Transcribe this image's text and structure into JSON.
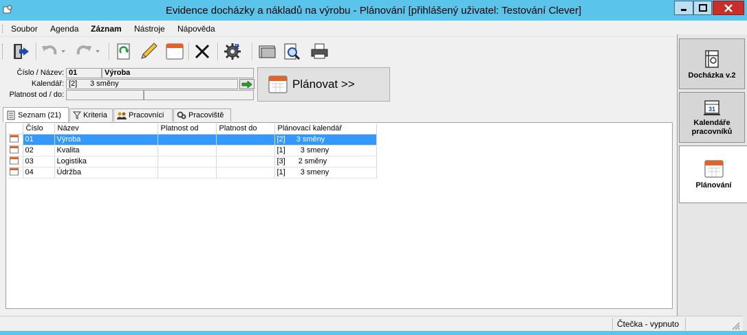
{
  "window": {
    "title": "Evidence docházky a nákladů na výrobu - Plánování [přihlášený uživatel: Testování Clever]"
  },
  "menu": [
    "Soubor",
    "Agenda",
    "Záznam",
    "Nástroje",
    "Nápověda"
  ],
  "toolbar": [
    "exit-icon",
    "undo-icon",
    "redo-icon",
    "refresh-icon",
    "edit-pencil-icon",
    "calendar-icon",
    "delete-icon",
    "settings-gear-icon",
    "folder-icon",
    "print-preview-icon",
    "print-icon"
  ],
  "form": {
    "cislo_label": "Číslo / Název:",
    "cislo": "01",
    "nazev": "Výroba",
    "kalendar_label": "Kalendář:",
    "kalendar_code": "[2]",
    "kalendar_name": "3 směny",
    "platnost_label": "Platnost od / do:",
    "platnost_od": "",
    "platnost_do": ""
  },
  "plan_button": {
    "label": "Plánovat >>"
  },
  "tabs": [
    "Seznam (21)",
    "Kriteria",
    "Pracovníci",
    "Pracoviště"
  ],
  "table": {
    "headers": [
      "Číslo",
      "Název",
      "Platnost od",
      "Platnost do",
      "Plánovací kalendář"
    ],
    "rows": [
      {
        "cislo": "01",
        "nazev": "Výroba",
        "od": "",
        "do": "",
        "kod": "[2]",
        "kal": "3 směny"
      },
      {
        "cislo": "02",
        "nazev": "Kvalita",
        "od": "",
        "do": "",
        "kod": "[1]",
        "kal": "3 smeny"
      },
      {
        "cislo": "03",
        "nazev": "Logistika",
        "od": "",
        "do": "",
        "kod": "[3]",
        "kal": "2 směny"
      },
      {
        "cislo": "04",
        "nazev": "Údržba",
        "od": "",
        "do": "",
        "kod": "[1]",
        "kal": "3 smeny"
      }
    ]
  },
  "side": [
    {
      "label": "Docházka v.2",
      "icon": "attendance-icon"
    },
    {
      "label": "Kalendáře pracovníků",
      "icon": "desk-calendar-icon"
    },
    {
      "label": "Plánování",
      "icon": "calendar-icon"
    }
  ],
  "status": {
    "reader": "Čtečka - vypnuto"
  },
  "colors": {
    "selection": "#3399ff",
    "titlebar": "#5ac4ea",
    "close": "#c7302a"
  }
}
